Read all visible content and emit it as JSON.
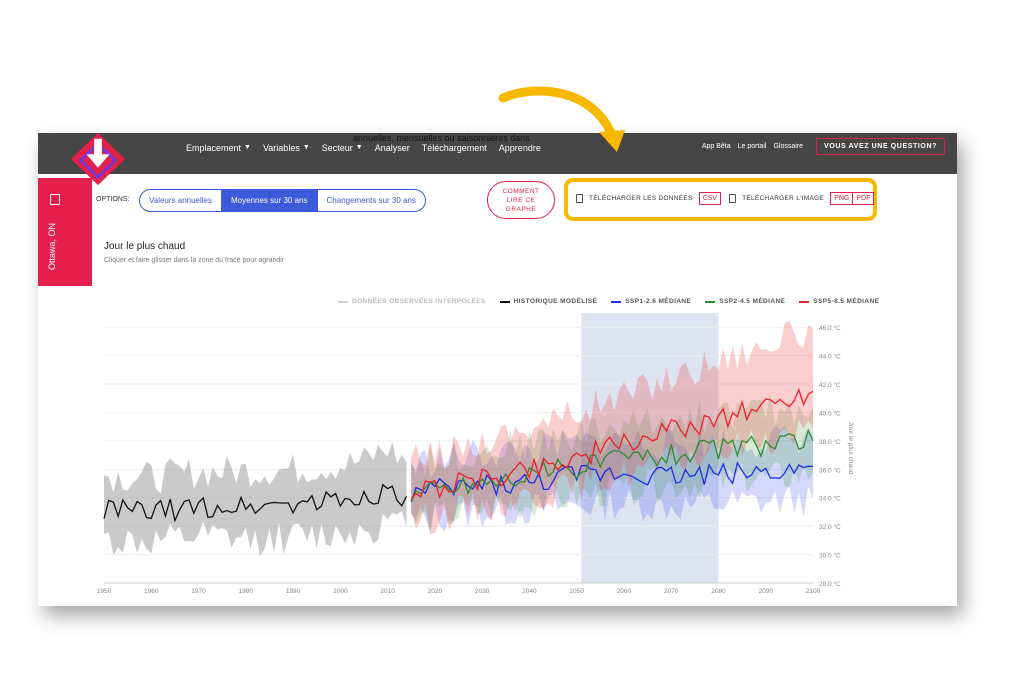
{
  "nav": {
    "items": [
      {
        "label": "Emplacement",
        "dropdown": true
      },
      {
        "label": "Variables",
        "dropdown": true
      },
      {
        "label": "Secteur",
        "dropdown": true
      },
      {
        "label": "Analyser",
        "dropdown": false
      },
      {
        "label": "Téléchargement",
        "dropdown": false
      },
      {
        "label": "Apprendre",
        "dropdown": false
      }
    ],
    "overlay_text": "annuelles, mensuelles ou saisonnières dans",
    "right_links": [
      "App Bêta",
      "Le portail",
      "Glossaire"
    ],
    "question_button": "VOUS AVEZ UNE QUESTION?"
  },
  "location": {
    "label": "Ottawa, ON"
  },
  "options": {
    "label": "OPTIONS:",
    "buttons": [
      "Valeurs annuelles",
      "Moyennes sur 30 ans",
      "Changements sur 30 ans"
    ],
    "active_index": 1
  },
  "howto_button": "COMMENT LIRE CE GRAPHE",
  "downloads": {
    "data_label": "TÉLÉCHARGER LES DONNÉES",
    "data_formats": [
      "CSV"
    ],
    "image_label": "TÉLÉCHARGER L'IMAGE",
    "image_formats": [
      "PNG",
      "PDF"
    ],
    "highlight_color": "#f6b800"
  },
  "chart_header": {
    "title": "Jour le plus chaud",
    "subtitle": "Cliquer et faire glisser dans la zone du tracé pour agrandir"
  },
  "chart_data": {
    "type": "line",
    "title": "Jour le plus chaud",
    "xlabel": "",
    "ylabel": "Jour le plus chaud",
    "xlim": [
      1950,
      2100
    ],
    "ylim": [
      28,
      47
    ],
    "x_ticks": [
      1950,
      1960,
      1970,
      1980,
      1990,
      2000,
      2010,
      2020,
      2030,
      2040,
      2050,
      2060,
      2070,
      2080,
      2090,
      2100
    ],
    "y_ticks": [
      "28.0 °C",
      "30.0 °C",
      "32.0 °C",
      "34.0 °C",
      "36.0 °C",
      "38.0 °C",
      "40.0 °C",
      "42.0 °C",
      "44.0 °C",
      "46.0 °C"
    ],
    "highlight_period": [
      2051,
      2080
    ],
    "grid": true,
    "legend_position": "top",
    "series": [
      {
        "name": "DONNÉES OBSERVÉES INTERPOLÉES",
        "color": "#cfcfcf",
        "x": [],
        "values": []
      },
      {
        "name": "HISTORIQUE MODÉLISÉ",
        "color": "#111111",
        "x": [
          1950,
          1960,
          1970,
          1980,
          1990,
          2000,
          2005,
          2010,
          2014
        ],
        "values": [
          33.2,
          33.0,
          33.3,
          33.4,
          33.6,
          33.8,
          34.0,
          34.6,
          34.1
        ],
        "band_low": [
          31.0,
          30.8,
          31.2,
          31.0,
          31.2,
          31.5,
          31.8,
          32.2,
          32.0
        ],
        "band_high": [
          35.6,
          35.4,
          35.8,
          35.9,
          36.0,
          36.3,
          36.6,
          37.5,
          36.5
        ]
      },
      {
        "name": "SSP1-2.6 MÉDIANE",
        "color": "#1a2fe0",
        "x": [
          2015,
          2020,
          2030,
          2040,
          2050,
          2060,
          2070,
          2080,
          2090,
          2100
        ],
        "values": [
          34.3,
          34.5,
          34.9,
          35.0,
          35.6,
          35.8,
          35.6,
          35.7,
          35.9,
          36.2
        ],
        "band_low": [
          32.3,
          32.6,
          33.0,
          33.2,
          33.5,
          33.6,
          33.4,
          33.6,
          33.7,
          33.9
        ],
        "band_high": [
          36.4,
          36.6,
          37.1,
          37.3,
          37.8,
          38.0,
          37.7,
          37.9,
          38.0,
          38.3
        ]
      },
      {
        "name": "SSP2-4.5 MÉDIANE",
        "color": "#2e8b2e",
        "x": [
          2015,
          2020,
          2030,
          2040,
          2050,
          2060,
          2070,
          2080,
          2090,
          2100
        ],
        "values": [
          34.3,
          34.6,
          35.1,
          35.6,
          36.2,
          36.8,
          37.1,
          37.5,
          37.7,
          38.0
        ],
        "band_low": [
          32.3,
          32.6,
          33.2,
          33.6,
          34.1,
          34.6,
          34.9,
          35.2,
          35.4,
          35.7
        ],
        "band_high": [
          36.4,
          36.7,
          37.3,
          37.9,
          38.5,
          39.1,
          39.5,
          39.9,
          40.1,
          40.4
        ]
      },
      {
        "name": "SSP5-8.5 MÉDIANE",
        "color": "#e8202a",
        "x": [
          2015,
          2020,
          2030,
          2040,
          2050,
          2060,
          2070,
          2080,
          2090,
          2100
        ],
        "values": [
          34.4,
          34.7,
          35.3,
          36.1,
          36.8,
          37.8,
          38.7,
          39.6,
          40.5,
          41.5
        ],
        "band_low": [
          32.3,
          32.7,
          33.4,
          34.1,
          34.8,
          35.7,
          36.5,
          37.3,
          38.1,
          38.9
        ],
        "band_high": [
          36.6,
          37.0,
          38.0,
          39.0,
          40.0,
          41.2,
          42.5,
          43.7,
          44.8,
          45.9
        ]
      }
    ]
  }
}
